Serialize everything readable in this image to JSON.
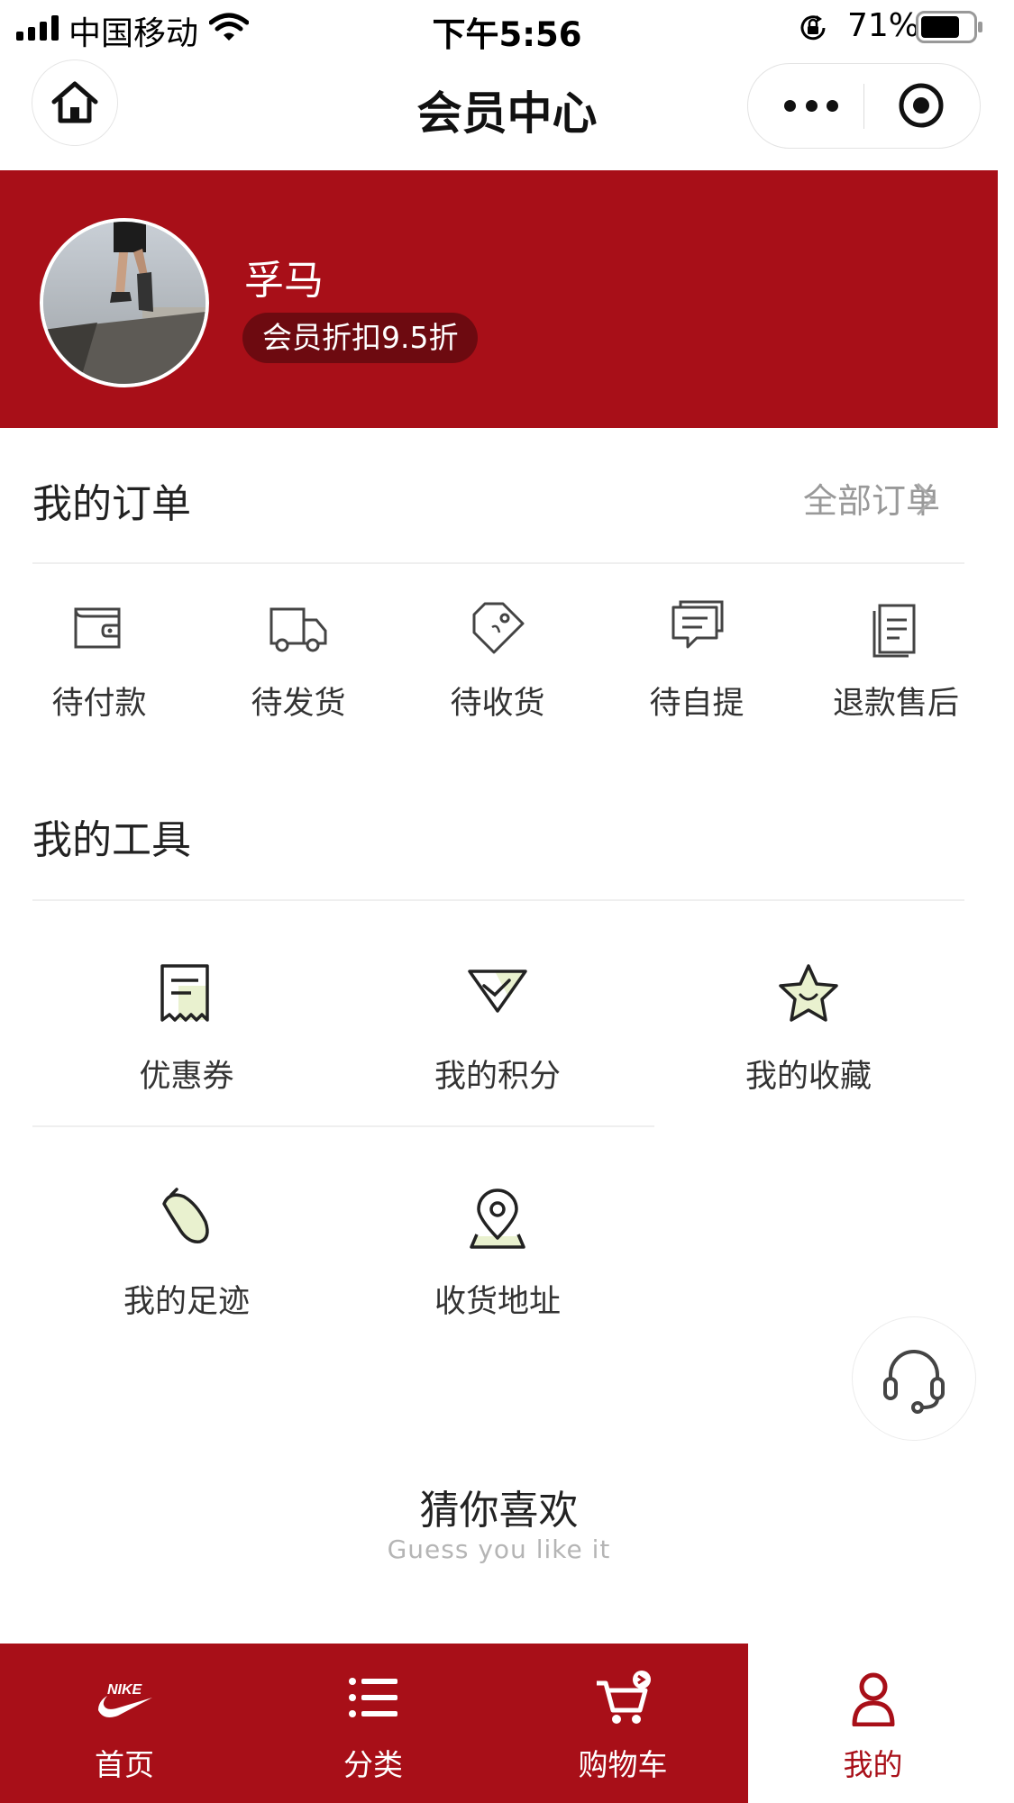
{
  "status_bar": {
    "carrier": "中国移动",
    "time": "下午5:56",
    "battery": "71%"
  },
  "nav": {
    "title": "会员中心",
    "icons": [
      "home-icon",
      "more-icon",
      "target-icon"
    ]
  },
  "profile": {
    "name": "孚马",
    "badge": "会员折扣9.5折"
  },
  "orders": {
    "title": "我的订单",
    "all_link": "全部订单",
    "items": [
      {
        "label": "待付款",
        "icon": "wallet-icon"
      },
      {
        "label": "待发货",
        "icon": "truck-icon"
      },
      {
        "label": "待收货",
        "icon": "tag-icon"
      },
      {
        "label": "待自提",
        "icon": "message-icon"
      },
      {
        "label": "退款售后",
        "icon": "document-icon"
      }
    ]
  },
  "tools": {
    "title": "我的工具",
    "items": [
      {
        "label": "优惠券",
        "icon": "coupon-icon"
      },
      {
        "label": "我的积分",
        "icon": "points-icon"
      },
      {
        "label": "我的收藏",
        "icon": "star-icon"
      },
      {
        "label": "我的足迹",
        "icon": "footprint-icon"
      },
      {
        "label": "收货地址",
        "icon": "location-icon"
      }
    ]
  },
  "guess": {
    "title": "猜你喜欢",
    "subtitle": "Guess you like it"
  },
  "tabbar": {
    "items": [
      {
        "label": "首页",
        "icon": "nike-logo-icon"
      },
      {
        "label": "分类",
        "icon": "list-icon"
      },
      {
        "label": "购物车",
        "icon": "cart-icon"
      },
      {
        "label": "我的",
        "icon": "user-icon"
      }
    ]
  },
  "colors": {
    "brand_red": "#a80f18",
    "badge_dark": "#6d0a10",
    "icon_accent": "#e9f1cf"
  }
}
